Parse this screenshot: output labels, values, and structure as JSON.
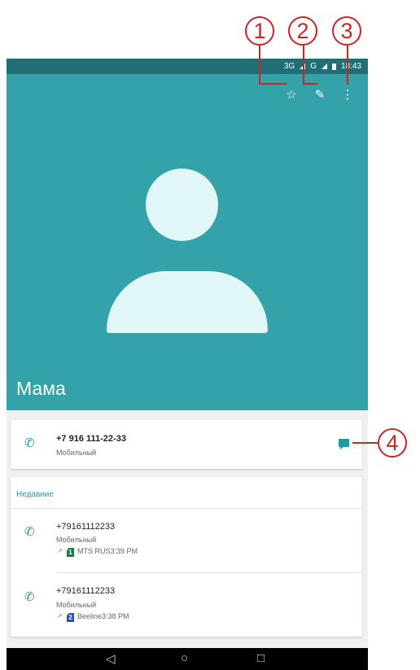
{
  "status_bar": {
    "network": "3G",
    "network2": "G",
    "time": "18:43"
  },
  "toolbar": {
    "favorite_icon": "☆",
    "edit_icon": "✎",
    "more_icon": "⋮"
  },
  "contact": {
    "name": "Мама"
  },
  "phone_card": {
    "number": "+7 916 111-22-33",
    "type": "Мобильный"
  },
  "recent": {
    "heading": "Недавние",
    "calls": [
      {
        "number": "+79161112233",
        "type": "Мобильный",
        "sim_number": "1",
        "carrier_time": "MTS RUS3:39 PM"
      },
      {
        "number": "+79161112233",
        "type": "Мобильный",
        "sim_number": "2",
        "carrier_time": "Beeline3:38 PM"
      }
    ]
  },
  "nav": {
    "back": "◁",
    "home": "○",
    "recents": "□"
  },
  "callouts": [
    "1",
    "2",
    "3",
    "4"
  ],
  "colors": {
    "header": "#33a2a9",
    "status_bar": "#1f6f74",
    "accent": "#1e9aa3",
    "callout": "#c62828"
  }
}
